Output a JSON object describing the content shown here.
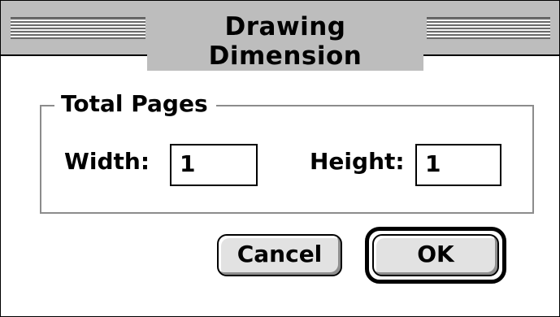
{
  "window": {
    "title": "Drawing Dimension"
  },
  "group": {
    "legend": "Total Pages",
    "width_label": "Width:",
    "width_value": "1",
    "height_label": "Height:",
    "height_value": "1"
  },
  "buttons": {
    "cancel_label": "Cancel",
    "ok_label": "OK"
  }
}
